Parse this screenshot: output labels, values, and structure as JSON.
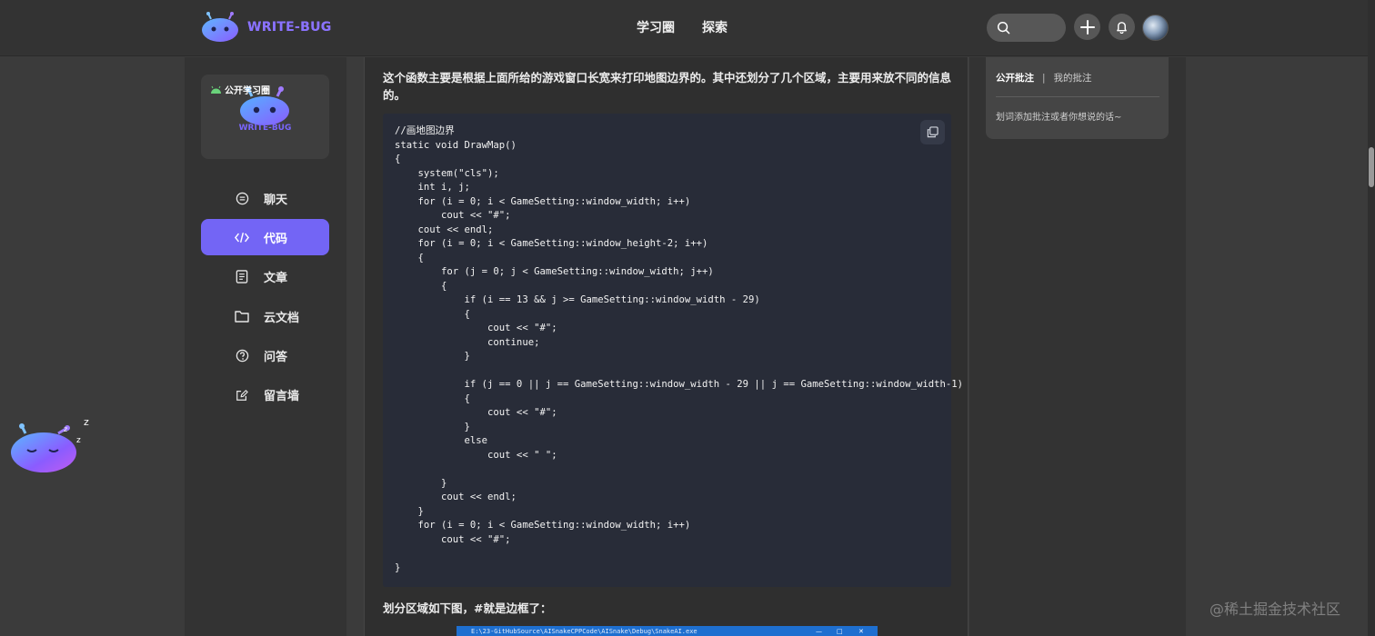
{
  "header": {
    "brand": "WRITE-BUG",
    "nav": [
      "学习圈",
      "探索"
    ],
    "icons": [
      "search-icon",
      "plus-icon",
      "bell-icon"
    ]
  },
  "sidebar": {
    "circle_badge": "公开学习圈",
    "circle_brand": "WRITE-BUG",
    "items": [
      {
        "label": "聊天",
        "icon": "chat-icon",
        "active": false
      },
      {
        "label": "代码",
        "icon": "code-icon",
        "active": true
      },
      {
        "label": "文章",
        "icon": "article-icon",
        "active": false
      },
      {
        "label": "云文档",
        "icon": "folder-icon",
        "active": false
      },
      {
        "label": "问答",
        "icon": "question-icon",
        "active": false
      },
      {
        "label": "留言墙",
        "icon": "edit-icon",
        "active": false
      }
    ]
  },
  "content": {
    "intro": "这个函数主要是根据上面所给的游戏窗口长宽来打印地图边界的。其中还划分了几个区域，主要用来放不同的信息的。",
    "code": "//画地图边界\nstatic void DrawMap()\n{\n    system(\"cls\");\n    int i, j;\n    for (i = 0; i < GameSetting::window_width; i++)\n        cout << \"#\";\n    cout << endl;\n    for (i = 0; i < GameSetting::window_height-2; i++)\n    {\n        for (j = 0; j < GameSetting::window_width; j++)\n        {\n            if (i == 13 && j >= GameSetting::window_width - 29)\n            {\n                cout << \"#\";\n                continue;\n            }\n\n            if (j == 0 || j == GameSetting::window_width - 29 || j == GameSetting::window_width-1)\n            {\n                cout << \"#\";\n            }\n            else\n                cout << \" \";\n\n        }\n        cout << endl;\n    }\n    for (i = 0; i < GameSetting::window_width; i++)\n        cout << \"#\";\n\n}",
    "section_text": "划分区域如下图，#就是边框了：",
    "embedded_title": "E:\\23-GitHubSource\\AISnakeCPPCode\\AISnake\\Debug\\SnakeAI.exe",
    "copy_icon": "copy-icon"
  },
  "annotations": {
    "tab_public": "公开批注",
    "separator": "|",
    "tab_mine": "我的批注",
    "hint": "划词添加批注或者你想说的话~"
  },
  "watermark": "@稀土掘金技术社区",
  "colors": {
    "accent": "#7365f5",
    "background": "#3b3b3b",
    "code_bg": "#282c38"
  }
}
